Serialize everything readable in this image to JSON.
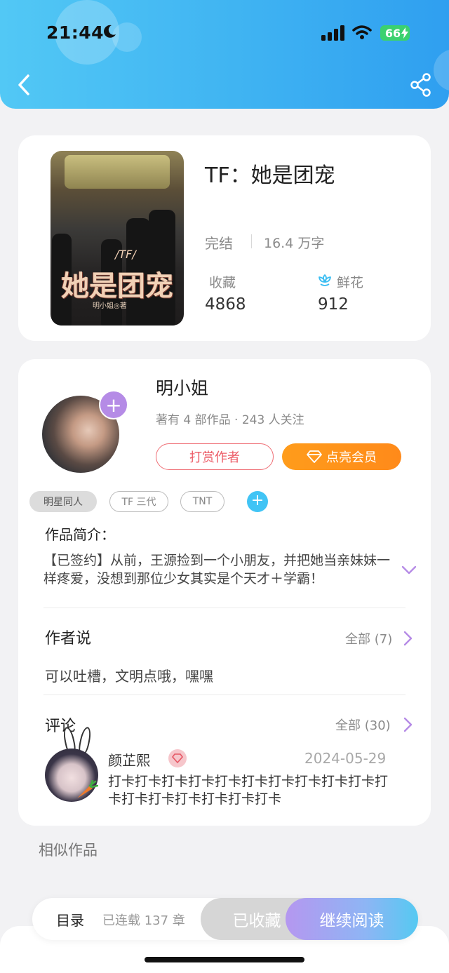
{
  "status_bar": {
    "time": "21:44",
    "battery": "66"
  },
  "book": {
    "title": "TF：她是团宠",
    "cover_title": "她是团宠",
    "cover_subtitle": "/TF/",
    "cover_author": "明小姐◎著",
    "status": "完结",
    "word_count": "16.4 万字",
    "favorites_label": "收藏",
    "favorites_value": "4868",
    "flowers_label": "鲜花",
    "flowers_value": "912"
  },
  "author": {
    "name": "明小姐",
    "meta": "著有 4 部作品 · 243 人关注",
    "reward_button": "打赏作者",
    "vip_button": "点亮会员"
  },
  "tags": [
    "明星同人",
    "TF 三代",
    "TNT"
  ],
  "intro": {
    "title": "作品简介：",
    "text": "【已签约】从前，王源捡到一个小朋友，并把她当亲妹妹一样疼爱，没想到那位少女其实是个天才＋学霸！"
  },
  "author_says": {
    "title": "作者说",
    "all_label": "全部 (7)",
    "text": "可以吐槽，文明点哦，嘿嘿"
  },
  "comments": {
    "title": "评论",
    "all_label": "全部 (30)",
    "items": [
      {
        "user": "颜芷熙",
        "date": "2024-05-29",
        "text": "打卡打卡打卡打卡打卡打卡打卡打卡打卡打卡打卡打卡打卡打卡打卡打卡打卡"
      }
    ]
  },
  "similar_title": "相似作品",
  "bottom_bar": {
    "toc": "目录",
    "chapters": "已连载 137 章",
    "favorited": "已收藏",
    "continue": "继续阅读"
  },
  "colors": {
    "header_gradient_start": "#52c8f5",
    "header_gradient_end": "#2f9ff0",
    "vip_orange": "#ff8a1a",
    "reward_red": "#ec5b66",
    "accent_purple": "#b58be6"
  }
}
